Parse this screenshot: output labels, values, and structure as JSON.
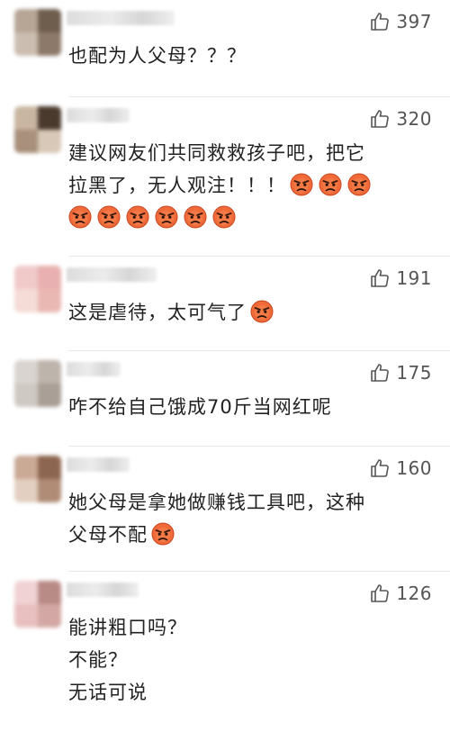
{
  "comments": [
    {
      "likes": "397",
      "lines": [
        {
          "text": "也配为人父母？？？",
          "emoji": 0
        }
      ],
      "avatar": [
        "#b7a595",
        "#6f5d4e",
        "#cbbdb0",
        "#8d7969"
      ],
      "name_width": 120
    },
    {
      "likes": "320",
      "lines": [
        {
          "text": "建议网友们共同救救孩子吧，把它",
          "emoji": 0
        },
        {
          "text": "拉黑了，无人观注！！！",
          "emoji": 3
        },
        {
          "text": "",
          "emoji": 6
        }
      ],
      "avatar": [
        "#c9b6a2",
        "#4a3a2e",
        "#a8907c",
        "#d8c8b8"
      ],
      "name_width": 70
    },
    {
      "likes": "191",
      "lines": [
        {
          "text": "这是虐待，太可气了",
          "emoji": 1
        }
      ],
      "avatar": [
        "#f0c9c9",
        "#e8b0b0",
        "#f5dcd6",
        "#eab8b3"
      ],
      "name_width": 100
    },
    {
      "likes": "175",
      "lines": [
        {
          "text": "咋不给自己饿成70斤当网红呢",
          "emoji": 0
        }
      ],
      "avatar": [
        "#d9d4cf",
        "#bdb4ab",
        "#cfc9c3",
        "#a99f96"
      ],
      "name_width": 60
    },
    {
      "likes": "160",
      "lines": [
        {
          "text": "她父母是拿她做赚钱工具吧，这种",
          "emoji": 0
        },
        {
          "text": "父母不配",
          "emoji": 1
        }
      ],
      "avatar": [
        "#caa995",
        "#8d6651",
        "#e3cfc1",
        "#b08c77"
      ],
      "name_width": 70
    },
    {
      "likes": "126",
      "lines": [
        {
          "text": "能讲粗口吗？",
          "emoji": 0
        },
        {
          "text": "不能？",
          "emoji": 0
        },
        {
          "text": "无话可说",
          "emoji": 0
        }
      ],
      "avatar": [
        "#f1d2d4",
        "#b98b87",
        "#e9c0c0",
        "#d3a8a4"
      ],
      "name_width": 80
    }
  ]
}
